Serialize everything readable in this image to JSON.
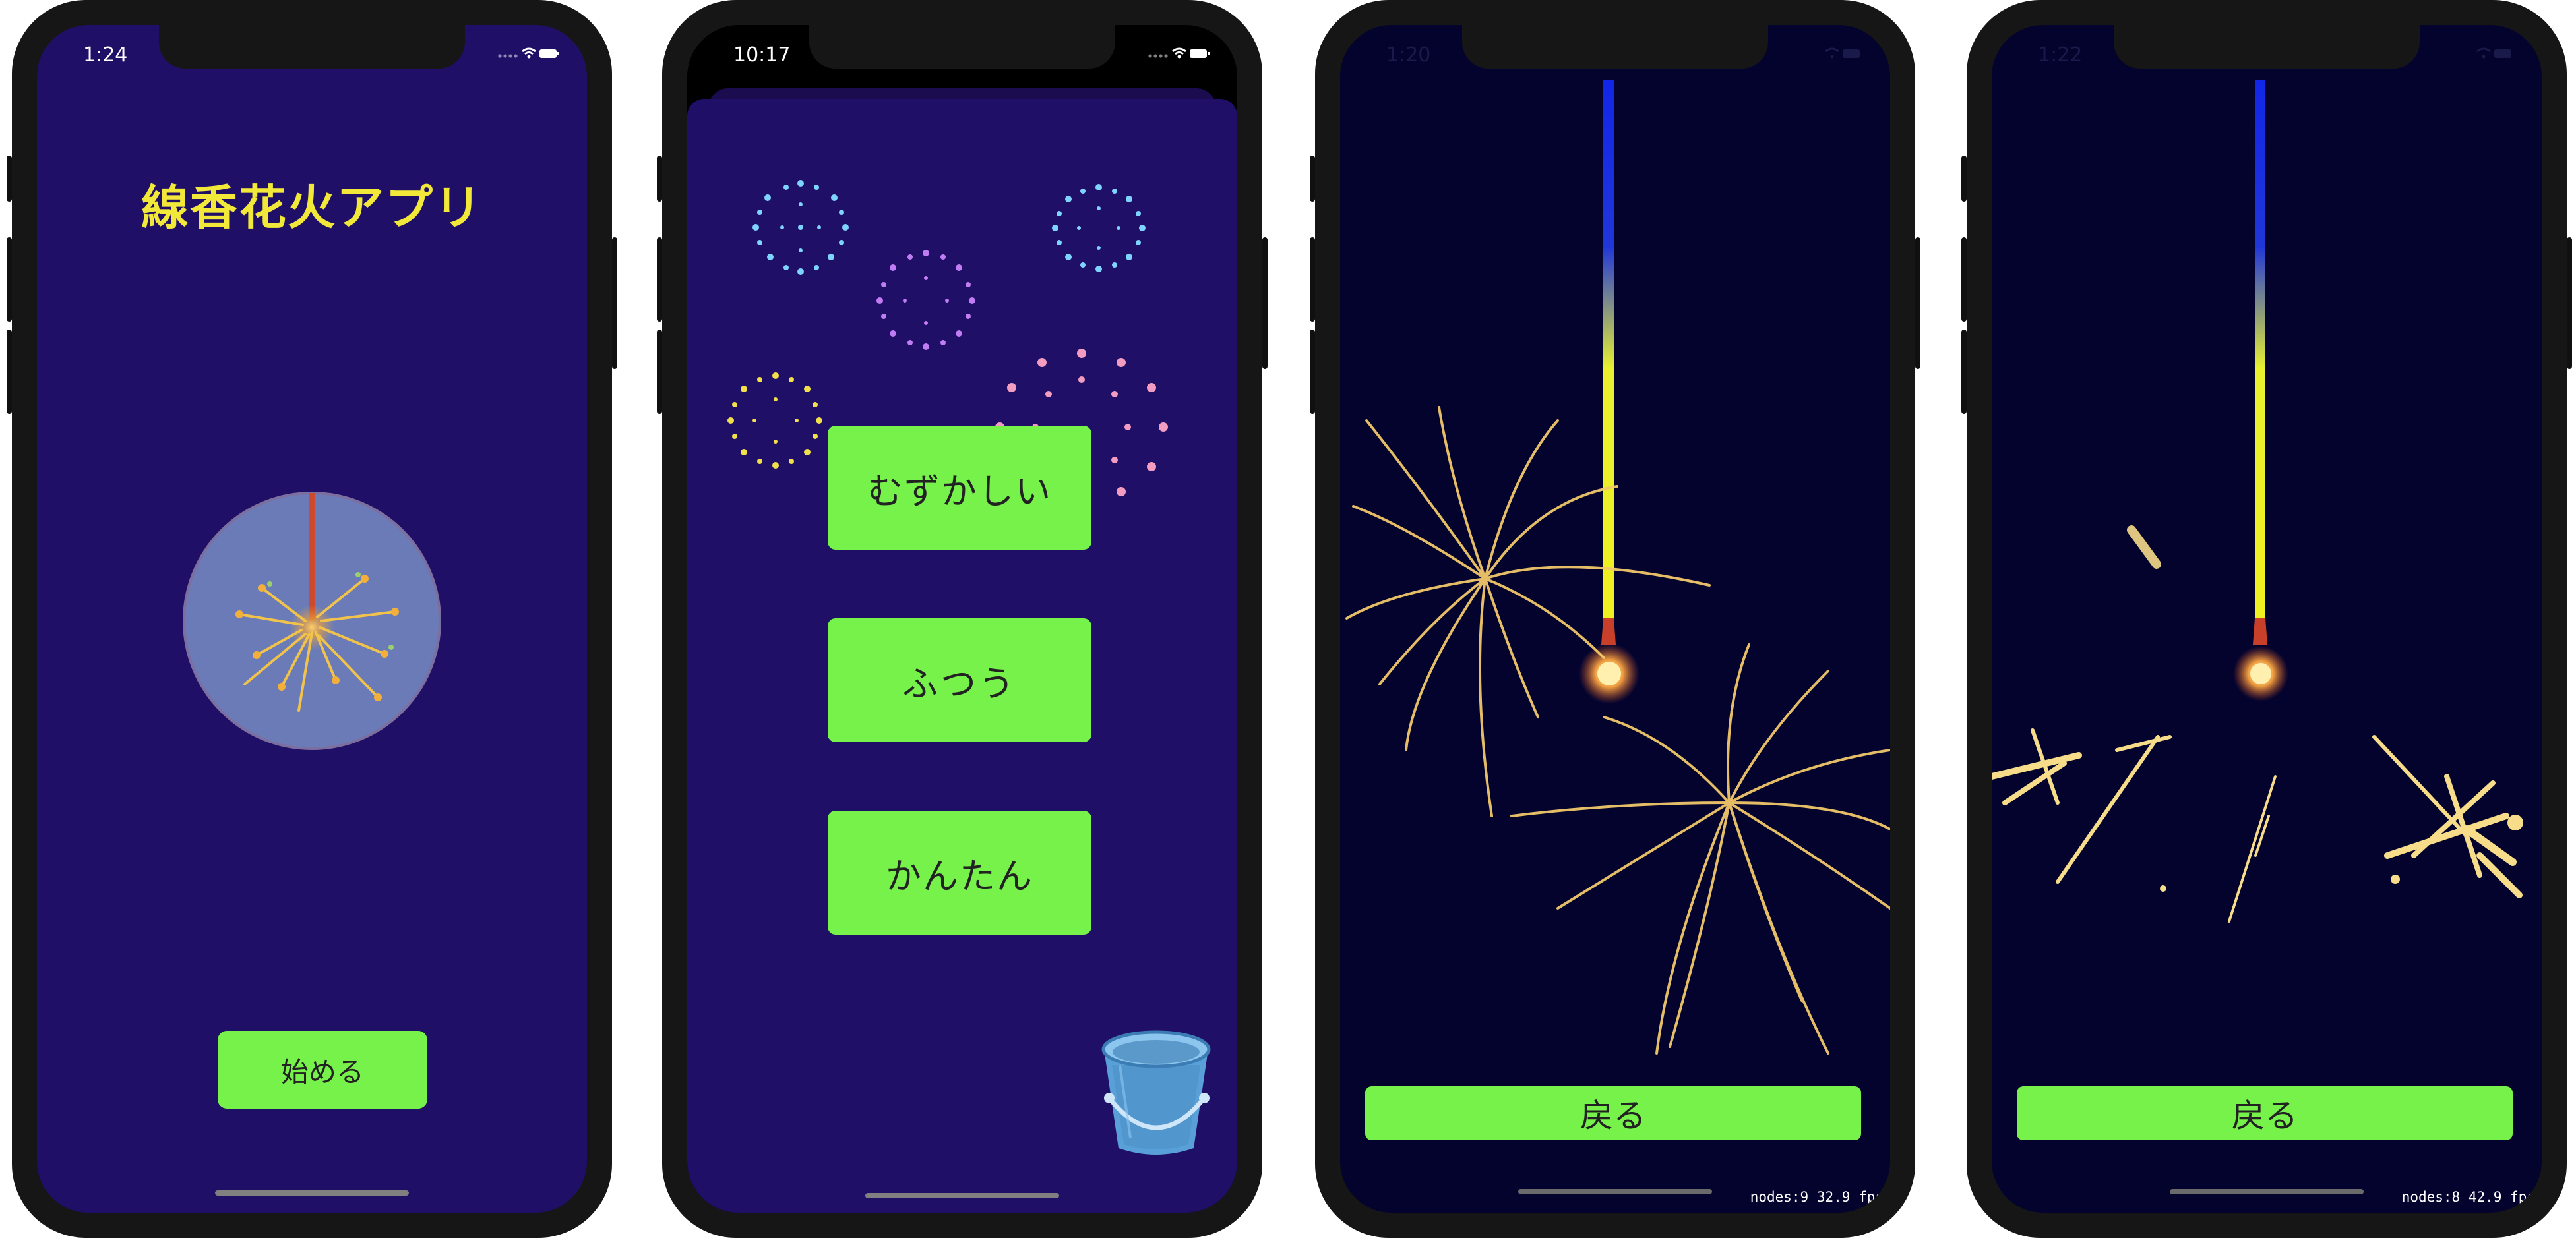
{
  "colors": {
    "indigo_bg": "#1f0f66",
    "night_bg": "#03032e",
    "button_green": "#77f24b",
    "title_yellow": "#f2e83a"
  },
  "screens": [
    {
      "time": "1:24",
      "app_title": "線香花火アプリ",
      "start_button": "始める"
    },
    {
      "time": "10:17",
      "difficulty_buttons": [
        "むずかしい",
        "ふつう",
        "かんたん"
      ],
      "bucket_icon": "bucket-icon"
    },
    {
      "time": "1:20",
      "back_button": "戻る",
      "debug_stats": "nodes:9  32.9 fps"
    },
    {
      "time": "1:22",
      "back_button": "戻る",
      "debug_stats": "nodes:8  42.9 fps"
    }
  ]
}
